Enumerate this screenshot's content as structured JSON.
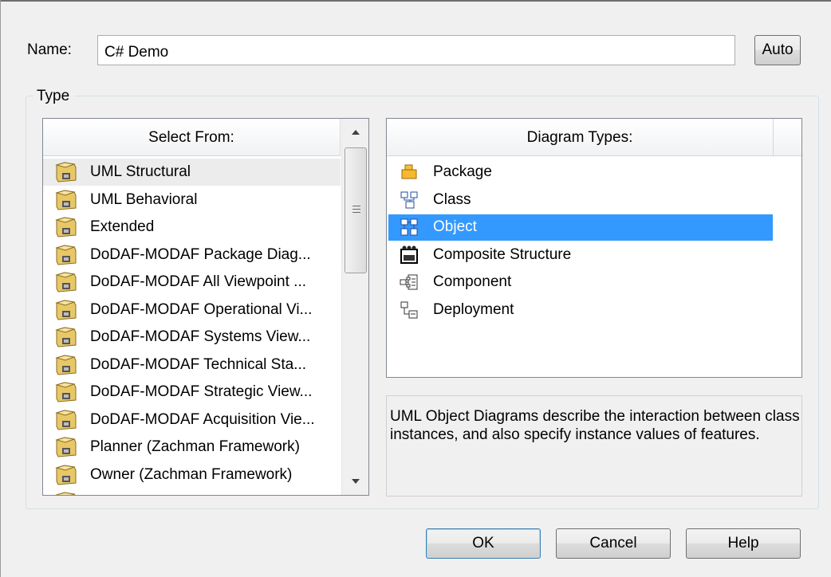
{
  "name": {
    "label": "Name:",
    "value": "C# Demo",
    "auto_label": "Auto"
  },
  "type_group": {
    "legend": "Type"
  },
  "select_from": {
    "header": "Select From:",
    "items": [
      {
        "label": "UML Structural",
        "selected": true
      },
      {
        "label": "UML Behavioral"
      },
      {
        "label": "Extended"
      },
      {
        "label": "DoDAF-MODAF Package Diag..."
      },
      {
        "label": "DoDAF-MODAF All Viewpoint ..."
      },
      {
        "label": "DoDAF-MODAF Operational Vi..."
      },
      {
        "label": "DoDAF-MODAF Systems View..."
      },
      {
        "label": "DoDAF-MODAF Technical Sta..."
      },
      {
        "label": "DoDAF-MODAF Strategic View..."
      },
      {
        "label": "DoDAF-MODAF Acquisition Vie..."
      },
      {
        "label": "Planner (Zachman Framework)"
      },
      {
        "label": "Owner (Zachman Framework)"
      }
    ],
    "icon": "package-folder-icon"
  },
  "diagram_types": {
    "header": "Diagram Types:",
    "items": [
      {
        "label": "Package",
        "icon": "package-diagram-icon"
      },
      {
        "label": "Class",
        "icon": "class-diagram-icon"
      },
      {
        "label": "Object",
        "icon": "object-diagram-icon",
        "selected": true
      },
      {
        "label": "Composite Structure",
        "icon": "composite-structure-icon"
      },
      {
        "label": "Component",
        "icon": "component-diagram-icon"
      },
      {
        "label": "Deployment",
        "icon": "deployment-diagram-icon"
      }
    ]
  },
  "description": "UML Object Diagrams describe the interaction between class instances, and also specify instance values of features.",
  "buttons": {
    "ok": "OK",
    "cancel": "Cancel",
    "help": "Help"
  },
  "colors": {
    "selection": "#3399ff",
    "dialog_bg": "#f0f0f0"
  }
}
